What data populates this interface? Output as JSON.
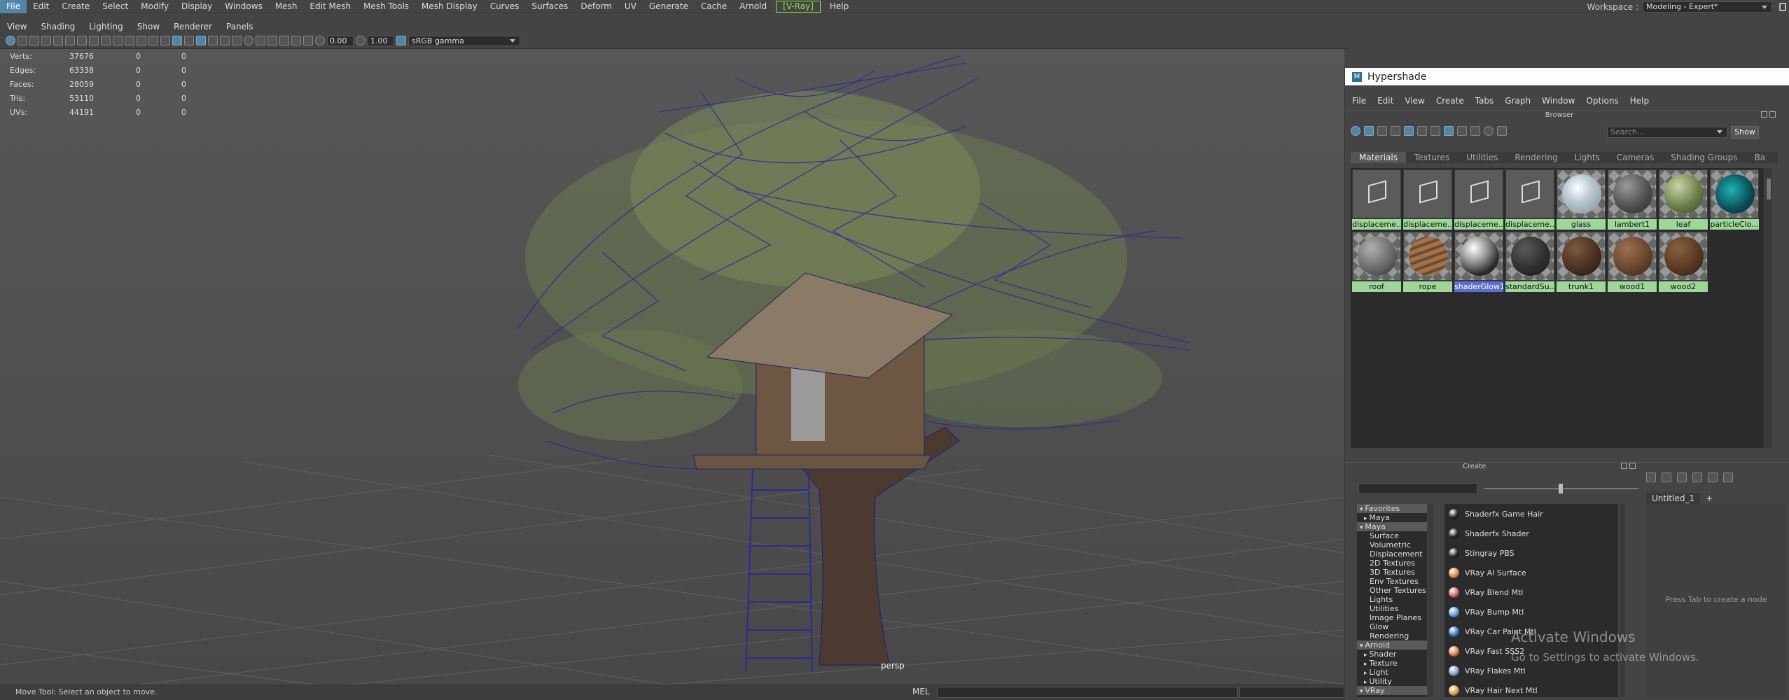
{
  "menubar": {
    "items": [
      "File",
      "Edit",
      "Create",
      "Select",
      "Modify",
      "Display",
      "Windows",
      "Mesh",
      "Edit Mesh",
      "Mesh Tools",
      "Mesh Display",
      "Curves",
      "Surfaces",
      "Deform",
      "UV",
      "Generate",
      "Cache",
      "Arnold",
      "[V-Ray]",
      "Help"
    ],
    "workspace_label": "Workspace :",
    "workspace_value": "Modeling - Expert*"
  },
  "viewport": {
    "menu": [
      "View",
      "Shading",
      "Lighting",
      "Show",
      "Renderer",
      "Panels"
    ],
    "toolbar": {
      "value1": "0.00",
      "value2": "1.00",
      "color_space": "sRGB gamma"
    },
    "hud": [
      {
        "label": "Verts:",
        "value": "37676",
        "a": "0",
        "b": "0"
      },
      {
        "label": "Edges:",
        "value": "63338",
        "a": "0",
        "b": "0"
      },
      {
        "label": "Faces:",
        "value": "28059",
        "a": "0",
        "b": "0"
      },
      {
        "label": "Tris:",
        "value": "53110",
        "a": "0",
        "b": "0"
      },
      {
        "label": "UVs:",
        "value": "44191",
        "a": "0",
        "b": "0"
      }
    ],
    "camera": "persp"
  },
  "status": {
    "text": "Move Tool: Select an object to move.",
    "mel_label": "MEL"
  },
  "hypershade": {
    "title": "Hypershade",
    "menu": [
      "File",
      "Edit",
      "View",
      "Create",
      "Tabs",
      "Graph",
      "Window",
      "Options",
      "Help"
    ],
    "browser_label": "Browser",
    "search_placeholder": "Search...",
    "show_label": "Show",
    "tabs": [
      "Materials",
      "Textures",
      "Utilities",
      "Rendering",
      "Lights",
      "Cameras",
      "Shading Groups",
      "Ba"
    ],
    "swatches": [
      {
        "name": "displaceme...",
        "kind": "cube"
      },
      {
        "name": "displaceme...",
        "kind": "cube"
      },
      {
        "name": "displaceme...",
        "kind": "cube"
      },
      {
        "name": "displaceme...",
        "kind": "cube"
      },
      {
        "name": "glass",
        "kind": "glass"
      },
      {
        "name": "lambert1",
        "kind": "lambert"
      },
      {
        "name": "leaf",
        "kind": "leaf"
      },
      {
        "name": "particleClo...",
        "kind": "particle"
      },
      {
        "name": "roof",
        "kind": "roof"
      },
      {
        "name": "rope",
        "kind": "rope"
      },
      {
        "name": "shaderGlow1",
        "kind": "glow",
        "selected": true
      },
      {
        "name": "standardSu...",
        "kind": "standard"
      },
      {
        "name": "trunk1",
        "kind": "trunk"
      },
      {
        "name": "wood1",
        "kind": "wood1"
      },
      {
        "name": "wood2",
        "kind": "wood2"
      }
    ],
    "create_label": "Create",
    "categories": [
      {
        "label": "Favorites",
        "type": "hdr"
      },
      {
        "label": "Maya",
        "type": "sub"
      },
      {
        "label": "Maya",
        "type": "hdr"
      },
      {
        "label": "Surface",
        "type": "item"
      },
      {
        "label": "Volumetric",
        "type": "item"
      },
      {
        "label": "Displacement",
        "type": "item"
      },
      {
        "label": "2D Textures",
        "type": "item"
      },
      {
        "label": "3D Textures",
        "type": "item"
      },
      {
        "label": "Env Textures",
        "type": "item"
      },
      {
        "label": "Other Textures",
        "type": "item"
      },
      {
        "label": "Lights",
        "type": "item"
      },
      {
        "label": "Utilities",
        "type": "item"
      },
      {
        "label": "Image Planes",
        "type": "item"
      },
      {
        "label": "Glow",
        "type": "item"
      },
      {
        "label": "Rendering",
        "type": "item"
      },
      {
        "label": "Arnold",
        "type": "hdr"
      },
      {
        "label": "Shader",
        "type": "sub"
      },
      {
        "label": "Texture",
        "type": "sub"
      },
      {
        "label": "Light",
        "type": "sub"
      },
      {
        "label": "Utility",
        "type": "sub"
      },
      {
        "label": "VRay",
        "type": "hdr"
      }
    ],
    "nodes": [
      {
        "label": "Shaderfx Game Hair",
        "color": "#222222"
      },
      {
        "label": "Shaderfx Shader",
        "color": "#222222"
      },
      {
        "label": "Stingray PBS",
        "color": "#222222"
      },
      {
        "label": "VRay Al Surface",
        "color": "#e08a4a"
      },
      {
        "label": "VRay Blend Mtl",
        "color": "#d86070"
      },
      {
        "label": "VRay Bump Mtl",
        "color": "#5c9ee0"
      },
      {
        "label": "VRay Car Paint Mtl",
        "color": "#3a7bd0"
      },
      {
        "label": "VRay Fast SSS2",
        "color": "#e08050"
      },
      {
        "label": "VRay Flakes Mtl",
        "color": "#8aa0c0"
      },
      {
        "label": "VRay Hair Next Mtl",
        "color": "#d8a040"
      }
    ],
    "node_editor_tab": "Untitled_1",
    "node_editor_add": "+",
    "node_editor_hint": "Press Tab to create a node"
  },
  "overlay": {
    "line1": "Activate Windows",
    "line2": "Go to Settings to activate Windows."
  }
}
